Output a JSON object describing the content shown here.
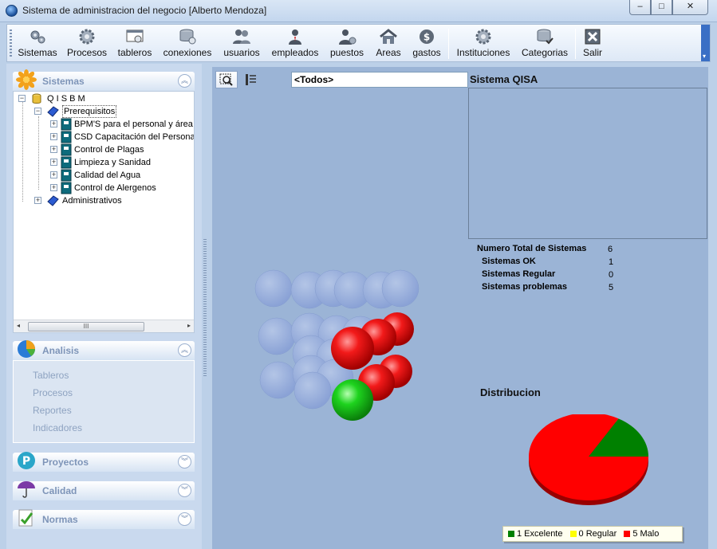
{
  "window": {
    "title": "Sistema de administracion del negocio [Alberto Mendoza]",
    "minimize": "–",
    "maximize": "□",
    "close": "✕"
  },
  "toolbar": {
    "items": [
      {
        "label": "Sistemas",
        "icon": "gears-icon"
      },
      {
        "label": "Procesos",
        "icon": "gear-icon"
      },
      {
        "label": "tableros",
        "icon": "board-icon"
      },
      {
        "label": "conexiones",
        "icon": "database-icon"
      },
      {
        "label": "usuarios",
        "icon": "users-icon"
      },
      {
        "label": "empleados",
        "icon": "employee-icon"
      },
      {
        "label": "puestos",
        "icon": "position-icon"
      },
      {
        "label": "Areas",
        "icon": "house-icon"
      },
      {
        "label": "gastos",
        "icon": "dollar-icon"
      },
      {
        "label": "Instituciones",
        "icon": "gear-icon"
      },
      {
        "label": "Categorias",
        "icon": "database-check-icon"
      },
      {
        "label": "Salir",
        "icon": "exit-icon"
      }
    ]
  },
  "sidebar": {
    "sistemas": {
      "label": "Sistemas",
      "tree": {
        "root": "Q I S B M",
        "prerequisitos": "Prerequisitos",
        "children": [
          "BPM'S para el personal y área",
          "CSD Capacitación del Persona",
          "Control de Plagas",
          "Limpieza y Sanidad",
          "Calidad del Agua",
          "Control de Alergenos"
        ],
        "administrativos": "Administrativos"
      },
      "scroll_grip": "III"
    },
    "analisis": {
      "label": "Analisis",
      "links": [
        "Tableros",
        "Procesos",
        "Reportes",
        "Indicadores"
      ]
    },
    "proyectos": {
      "label": "Proyectos"
    },
    "calidad": {
      "label": "Calidad"
    },
    "normas": {
      "label": "Normas"
    }
  },
  "main": {
    "filter_value": "<Todos>",
    "system_title": "Sistema QISA",
    "stats": {
      "total_label": "Numero Total de Sistemas",
      "total_value": "6",
      "ok_label": "Sistemas OK",
      "ok_value": "1",
      "regular_label": "Sistemas Regular",
      "regular_value": "0",
      "problem_label": "Sistemas problemas",
      "problem_value": "5"
    },
    "distribution_title": "Distribucion",
    "colors": {
      "ok": "#008000",
      "regular": "#ffff00",
      "bad": "#ff0000",
      "empty": "#8fa8d8"
    },
    "legend": [
      {
        "label": "1 Excelente",
        "color": "#008000"
      },
      {
        "label": "0 Regular",
        "color": "#ffff00"
      },
      {
        "label": "5 Malo",
        "color": "#ff0000"
      }
    ]
  },
  "chart_data": {
    "type": "pie",
    "title": "Distribucion",
    "categories": [
      "Excelente",
      "Regular",
      "Malo"
    ],
    "values": [
      1,
      0,
      5
    ],
    "colors": [
      "#008000",
      "#ffff00",
      "#ff0000"
    ]
  }
}
